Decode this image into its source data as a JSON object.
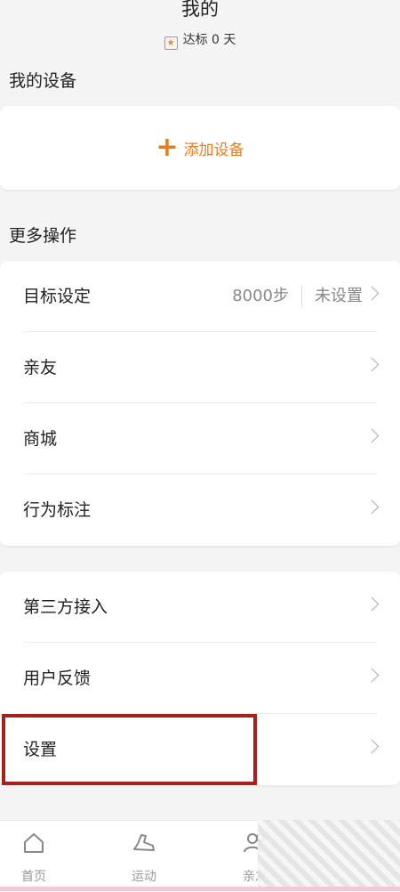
{
  "header": {
    "title": "我的",
    "goal_label": "达标",
    "goal_days": "0",
    "goal_unit": "天"
  },
  "my_devices": {
    "section_title": "我的设备",
    "add_label": "添加设备"
  },
  "more_actions": {
    "section_title": "更多操作",
    "items": [
      {
        "label": "目标设定",
        "steps": "8000步",
        "status": "未设置"
      },
      {
        "label": "亲友"
      },
      {
        "label": "商城"
      },
      {
        "label": "行为标注"
      }
    ]
  },
  "other": {
    "items": [
      {
        "label": "第三方接入"
      },
      {
        "label": "用户反馈"
      },
      {
        "label": "设置"
      }
    ]
  },
  "tabbar": {
    "items": [
      {
        "label": "首页",
        "icon": "home-icon"
      },
      {
        "label": "运动",
        "icon": "shoe-icon"
      },
      {
        "label": "亲友",
        "icon": "friends-icon"
      }
    ]
  },
  "colors": {
    "accent": "#e27d21",
    "highlight_border": "#a6201c",
    "background": "#f5f4f4"
  }
}
